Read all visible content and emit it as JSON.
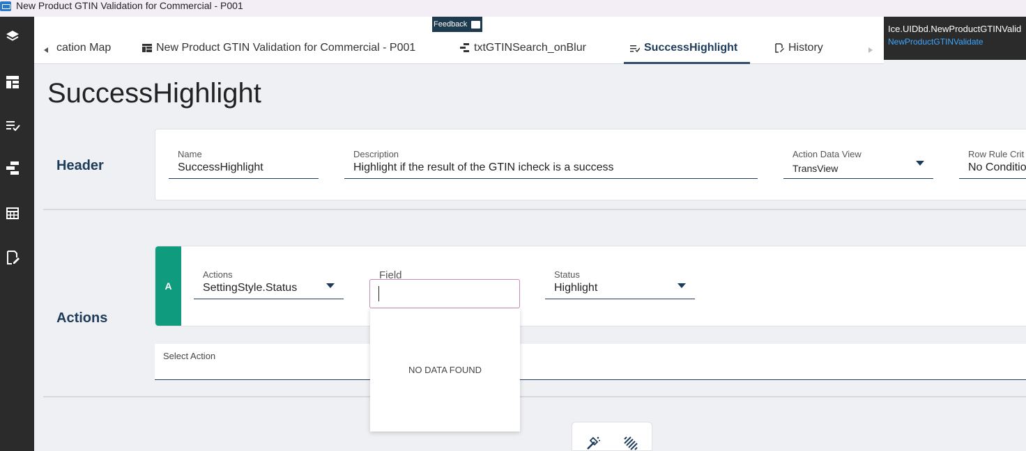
{
  "window": {
    "title": "New Product GTIN Validation for Commercial - P001"
  },
  "rail": {
    "icons": [
      "layers-icon",
      "layout-icon",
      "checklist-icon",
      "hierarchy-icon",
      "table-icon",
      "edit-doc-icon"
    ]
  },
  "feedback": {
    "label": "Feedback"
  },
  "tabs": [
    {
      "label": "cation Map"
    },
    {
      "label": "New Product GTIN Validation for Commercial - P001"
    },
    {
      "label": "txtGTINSearch_onBlur"
    },
    {
      "label": "SuccessHighlight"
    },
    {
      "label": "History"
    }
  ],
  "info": {
    "line1": "Ice.UIDbd.NewProductGTINValid",
    "line2": "NewProductGTINValidate"
  },
  "page": {
    "title": "SuccessHighlight"
  },
  "header": {
    "section_label": "Header",
    "name": {
      "label": "Name",
      "value": "SuccessHighlight"
    },
    "description": {
      "label": "Description",
      "value": "Highlight if the result of the GTIN icheck is a success"
    },
    "action_data_view": {
      "label": "Action Data View",
      "value": "TransView"
    },
    "row_rule": {
      "label": "Row Rule Crit",
      "value": "No Conditio"
    }
  },
  "actions": {
    "section_label": "Actions",
    "badge": "A",
    "actions_field": {
      "label": "Actions",
      "value": "SettingStyle.Status"
    },
    "field": {
      "label": "Field",
      "value": ""
    },
    "status": {
      "label": "Status",
      "value": "Highlight"
    },
    "dropdown_empty": "NO DATA FOUND",
    "select_action": "Select Action"
  },
  "colors": {
    "accent": "#1d3b5a",
    "badge": "#0f9b7d",
    "rail": "#2b2b2b",
    "link": "#3ea6ff"
  }
}
